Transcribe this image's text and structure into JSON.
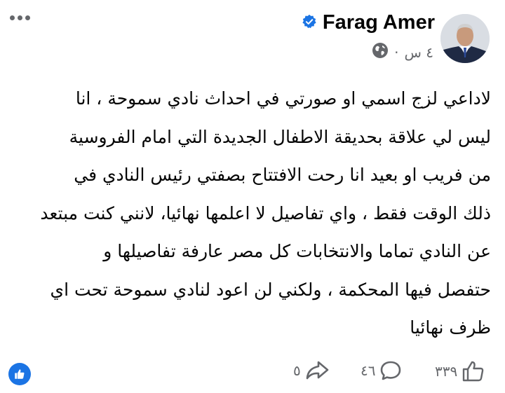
{
  "post": {
    "author_name": "Farag Amer",
    "verified_icon": "verified-badge-icon",
    "time": "٤ س",
    "separator": "·",
    "audience_icon": "globe-icon",
    "more_icon": "more-options-icon",
    "text_lines": [
      "لاداعي لزج اسمي او صورتي في احداث نادي سموحة ، انا",
      "ليس لي علاقة بحديقة الاطفال الجديدة  التي امام الفروسية",
      "من فريب او بعيد انا رحت الافتتاح بصفتي رئيس  النادي في",
      "ذلك الوقت فقط ، واي تفاصيل لا اعلمها نهائيا، لانني كنت مبتعد",
      "عن النادي تماما والانتخابات  كل مصر عارفة تفاصيلها و",
      "حتفصل فيها المحكمة  ، ولكني لن اعود لنادي سموحة تحت اي",
      "ظرف نهائيا"
    ]
  },
  "stats": {
    "reactions_icon": "like-reaction-icon",
    "likes": "٣٣٩",
    "comments": "٤٦",
    "shares": "٥"
  },
  "colors": {
    "accent": "#1b74e4",
    "muted": "#65676b",
    "text": "#050505"
  }
}
